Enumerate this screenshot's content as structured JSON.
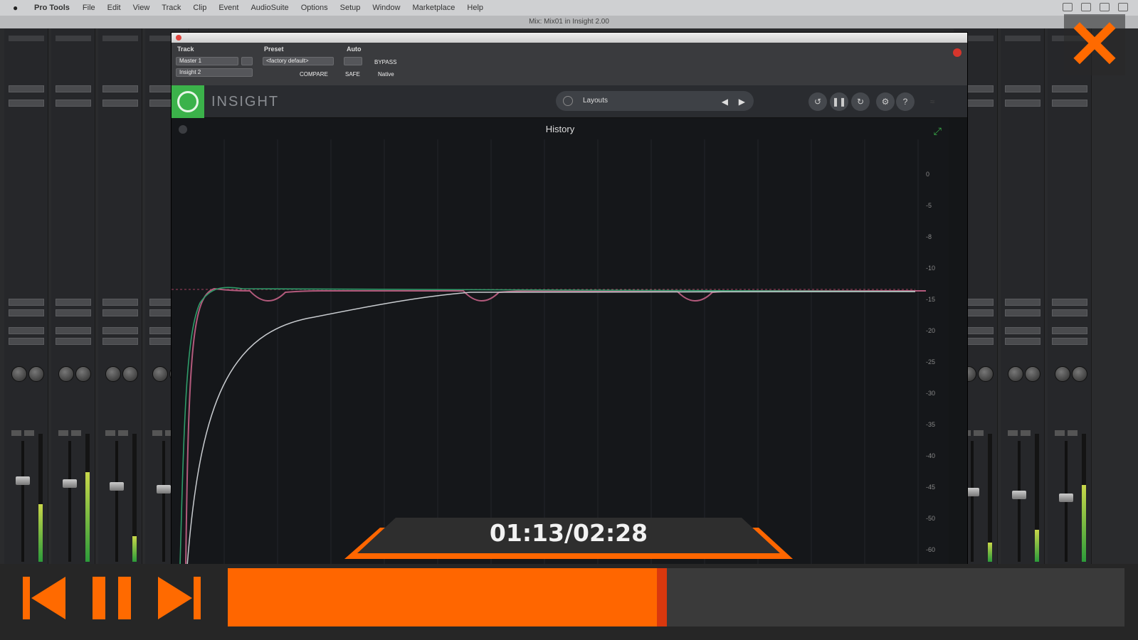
{
  "menubar": {
    "app": "Pro Tools",
    "items": [
      "File",
      "Edit",
      "View",
      "Track",
      "Clip",
      "Event",
      "AudioSuite",
      "Options",
      "Setup",
      "Window",
      "Marketplace",
      "Help"
    ]
  },
  "document_title": "Mix: Mix01 in Insight 2.00",
  "plugin": {
    "header": {
      "track_label": "Track",
      "preset_label": "Preset",
      "auto_label": "Auto",
      "track_value": "Master 1",
      "insert_value": "Insight 2",
      "preset_value": "<factory default>",
      "compare": "COMPARE",
      "bypass": "BYPASS",
      "safe": "SAFE",
      "native": "Native"
    },
    "brand": "INSIGHT",
    "preset_name": "Layouts",
    "panel_title": "History",
    "scale_ticks": [
      "0",
      "-5",
      "-8",
      "-10",
      "-15",
      "-20",
      "-25",
      "-30",
      "-35",
      "-40",
      "-45",
      "-50",
      "-60"
    ],
    "colors": {
      "logo_green": "#3bb24a",
      "curve_pink": "#b35a7c",
      "curve_green": "#2f9c6a",
      "curve_white": "#c9ccd0"
    }
  },
  "player": {
    "time": "01:13/02:28",
    "progress": 0.49,
    "accent": "#ff6600",
    "icons": [
      "skip-back-icon",
      "pause-icon",
      "skip-forward-icon",
      "close-icon"
    ]
  }
}
